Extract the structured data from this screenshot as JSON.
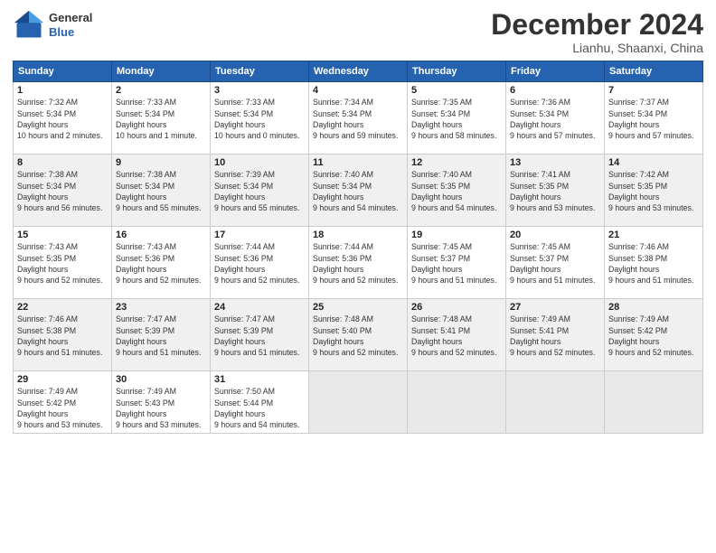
{
  "header": {
    "logo_line1": "General",
    "logo_line2": "Blue",
    "month_title": "December 2024",
    "location": "Lianhu, Shaanxi, China"
  },
  "weekdays": [
    "Sunday",
    "Monday",
    "Tuesday",
    "Wednesday",
    "Thursday",
    "Friday",
    "Saturday"
  ],
  "weeks": [
    [
      {
        "day": 1,
        "rise": "7:32 AM",
        "set": "5:34 PM",
        "hours": "10 hours and 2 minutes."
      },
      {
        "day": 2,
        "rise": "7:33 AM",
        "set": "5:34 PM",
        "hours": "10 hours and 1 minute."
      },
      {
        "day": 3,
        "rise": "7:33 AM",
        "set": "5:34 PM",
        "hours": "10 hours and 0 minutes."
      },
      {
        "day": 4,
        "rise": "7:34 AM",
        "set": "5:34 PM",
        "hours": "9 hours and 59 minutes."
      },
      {
        "day": 5,
        "rise": "7:35 AM",
        "set": "5:34 PM",
        "hours": "9 hours and 58 minutes."
      },
      {
        "day": 6,
        "rise": "7:36 AM",
        "set": "5:34 PM",
        "hours": "9 hours and 57 minutes."
      },
      {
        "day": 7,
        "rise": "7:37 AM",
        "set": "5:34 PM",
        "hours": "9 hours and 57 minutes."
      }
    ],
    [
      {
        "day": 8,
        "rise": "7:38 AM",
        "set": "5:34 PM",
        "hours": "9 hours and 56 minutes."
      },
      {
        "day": 9,
        "rise": "7:38 AM",
        "set": "5:34 PM",
        "hours": "9 hours and 55 minutes."
      },
      {
        "day": 10,
        "rise": "7:39 AM",
        "set": "5:34 PM",
        "hours": "9 hours and 55 minutes."
      },
      {
        "day": 11,
        "rise": "7:40 AM",
        "set": "5:34 PM",
        "hours": "9 hours and 54 minutes."
      },
      {
        "day": 12,
        "rise": "7:40 AM",
        "set": "5:35 PM",
        "hours": "9 hours and 54 minutes."
      },
      {
        "day": 13,
        "rise": "7:41 AM",
        "set": "5:35 PM",
        "hours": "9 hours and 53 minutes."
      },
      {
        "day": 14,
        "rise": "7:42 AM",
        "set": "5:35 PM",
        "hours": "9 hours and 53 minutes."
      }
    ],
    [
      {
        "day": 15,
        "rise": "7:43 AM",
        "set": "5:35 PM",
        "hours": "9 hours and 52 minutes."
      },
      {
        "day": 16,
        "rise": "7:43 AM",
        "set": "5:36 PM",
        "hours": "9 hours and 52 minutes."
      },
      {
        "day": 17,
        "rise": "7:44 AM",
        "set": "5:36 PM",
        "hours": "9 hours and 52 minutes."
      },
      {
        "day": 18,
        "rise": "7:44 AM",
        "set": "5:36 PM",
        "hours": "9 hours and 52 minutes."
      },
      {
        "day": 19,
        "rise": "7:45 AM",
        "set": "5:37 PM",
        "hours": "9 hours and 51 minutes."
      },
      {
        "day": 20,
        "rise": "7:45 AM",
        "set": "5:37 PM",
        "hours": "9 hours and 51 minutes."
      },
      {
        "day": 21,
        "rise": "7:46 AM",
        "set": "5:38 PM",
        "hours": "9 hours and 51 minutes."
      }
    ],
    [
      {
        "day": 22,
        "rise": "7:46 AM",
        "set": "5:38 PM",
        "hours": "9 hours and 51 minutes."
      },
      {
        "day": 23,
        "rise": "7:47 AM",
        "set": "5:39 PM",
        "hours": "9 hours and 51 minutes."
      },
      {
        "day": 24,
        "rise": "7:47 AM",
        "set": "5:39 PM",
        "hours": "9 hours and 51 minutes."
      },
      {
        "day": 25,
        "rise": "7:48 AM",
        "set": "5:40 PM",
        "hours": "9 hours and 52 minutes."
      },
      {
        "day": 26,
        "rise": "7:48 AM",
        "set": "5:41 PM",
        "hours": "9 hours and 52 minutes."
      },
      {
        "day": 27,
        "rise": "7:49 AM",
        "set": "5:41 PM",
        "hours": "9 hours and 52 minutes."
      },
      {
        "day": 28,
        "rise": "7:49 AM",
        "set": "5:42 PM",
        "hours": "9 hours and 52 minutes."
      }
    ],
    [
      {
        "day": 29,
        "rise": "7:49 AM",
        "set": "5:42 PM",
        "hours": "9 hours and 53 minutes."
      },
      {
        "day": 30,
        "rise": "7:49 AM",
        "set": "5:43 PM",
        "hours": "9 hours and 53 minutes."
      },
      {
        "day": 31,
        "rise": "7:50 AM",
        "set": "5:44 PM",
        "hours": "9 hours and 54 minutes."
      },
      null,
      null,
      null,
      null
    ]
  ]
}
